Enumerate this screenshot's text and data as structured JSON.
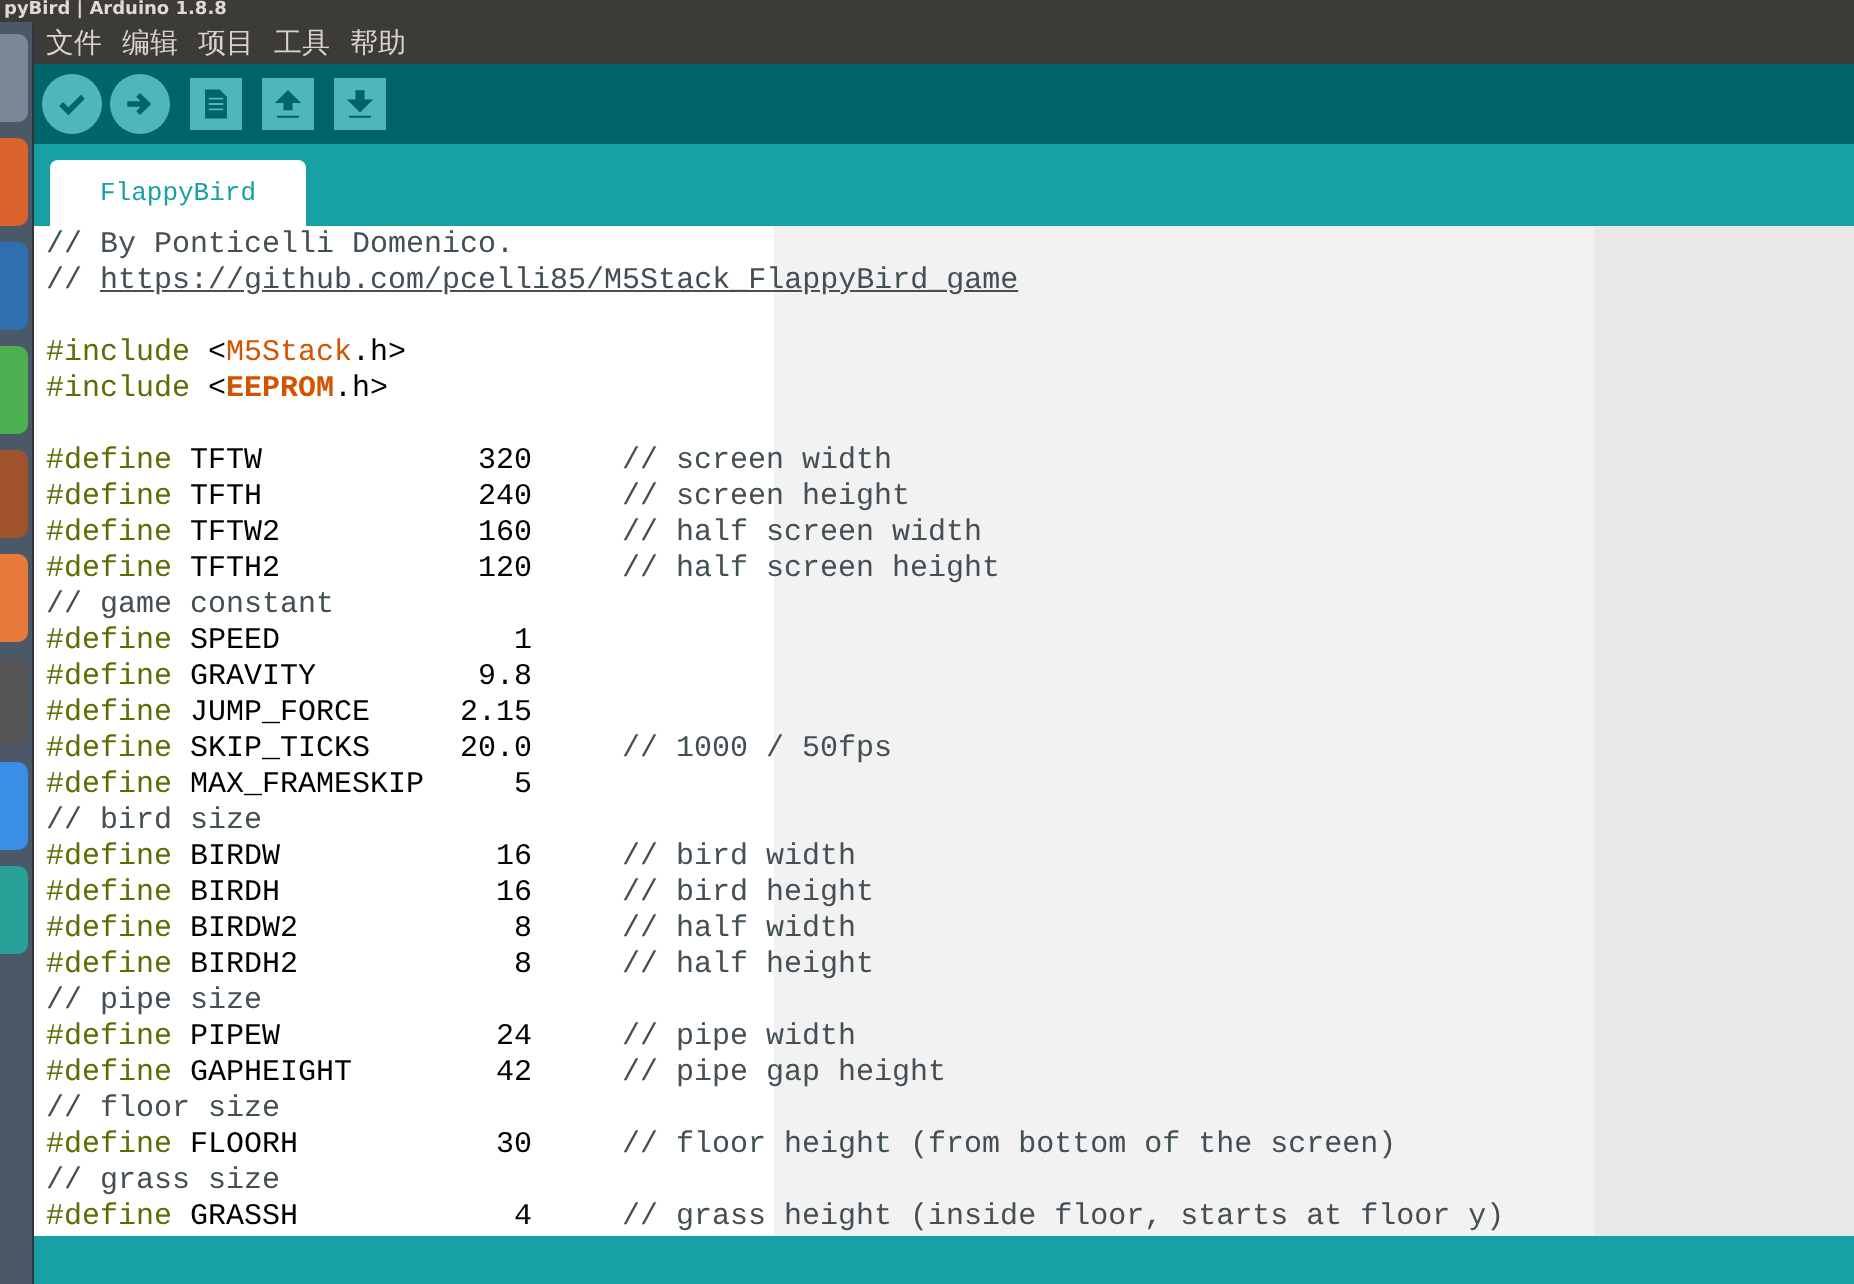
{
  "window": {
    "title": "pyBird | Arduino 1.8.8"
  },
  "menu": [
    "文件",
    "编辑",
    "项目",
    "工具",
    "帮助"
  ],
  "toolbar": [
    {
      "kind": "verify"
    },
    {
      "kind": "upload"
    },
    {
      "kind": "new"
    },
    {
      "kind": "open"
    },
    {
      "kind": "save"
    }
  ],
  "tabs": [
    {
      "label": "FlappyBird",
      "selected": true
    }
  ],
  "editor": {
    "lines": [
      {
        "kind": "comment",
        "text": "// By Ponticelli Domenico."
      },
      {
        "kind": "comment_link",
        "prefix": "//",
        "link": "https://github.com/pcelli85/M5Stack_FlappyBird_game"
      },
      {
        "kind": "blank"
      },
      {
        "kind": "include",
        "directive": "#include",
        "open": "<",
        "library": "M5Stack",
        "close": ".h>",
        "bold": false
      },
      {
        "kind": "include",
        "directive": "#include",
        "open": "<",
        "library": "EEPROM",
        "close": ".h>",
        "bold": true
      },
      {
        "kind": "blank"
      },
      {
        "kind": "define",
        "directive": "#define",
        "name": "TFTW",
        "value": "320",
        "comment": "// screen width"
      },
      {
        "kind": "define",
        "directive": "#define",
        "name": "TFTH",
        "value": "240",
        "comment": "// screen height"
      },
      {
        "kind": "define",
        "directive": "#define",
        "name": "TFTW2",
        "value": "160",
        "comment": "// half screen width"
      },
      {
        "kind": "define",
        "directive": "#define",
        "name": "TFTH2",
        "value": "120",
        "comment": "// half screen height"
      },
      {
        "kind": "comment",
        "text": "// game constant"
      },
      {
        "kind": "define",
        "directive": "#define",
        "name": "SPEED",
        "value": "1"
      },
      {
        "kind": "define",
        "directive": "#define",
        "name": "GRAVITY",
        "value": "9.8"
      },
      {
        "kind": "define",
        "directive": "#define",
        "name": "JUMP_FORCE",
        "value": "2.15"
      },
      {
        "kind": "define",
        "directive": "#define",
        "name": "SKIP_TICKS",
        "value": "20.0",
        "comment": "// 1000 / 50fps"
      },
      {
        "kind": "define",
        "directive": "#define",
        "name": "MAX_FRAMESKIP",
        "value": "5"
      },
      {
        "kind": "comment",
        "text": "// bird size"
      },
      {
        "kind": "define",
        "directive": "#define",
        "name": "BIRDW",
        "value": "16",
        "comment": "// bird width"
      },
      {
        "kind": "define",
        "directive": "#define",
        "name": "BIRDH",
        "value": "16",
        "comment": "// bird height"
      },
      {
        "kind": "define",
        "directive": "#define",
        "name": "BIRDW2",
        "value": "8",
        "comment": "// half width"
      },
      {
        "kind": "define",
        "directive": "#define",
        "name": "BIRDH2",
        "value": "8",
        "comment": "// half height"
      },
      {
        "kind": "comment",
        "text": "// pipe size"
      },
      {
        "kind": "define",
        "directive": "#define",
        "name": "PIPEW",
        "value": "24",
        "comment": "// pipe width"
      },
      {
        "kind": "define",
        "directive": "#define",
        "name": "GAPHEIGHT",
        "value": "42",
        "comment": "// pipe gap height"
      },
      {
        "kind": "comment",
        "text": "// floor size"
      },
      {
        "kind": "define",
        "directive": "#define",
        "name": "FLOORH",
        "value": "30",
        "comment": "// floor height (from bottom of the screen)"
      },
      {
        "kind": "comment",
        "text": "// grass size"
      },
      {
        "kind": "define",
        "directive": "#define",
        "name": "GRASSH",
        "value": "4",
        "comment": "// grass height (inside floor, starts at floor y)"
      }
    ]
  }
}
